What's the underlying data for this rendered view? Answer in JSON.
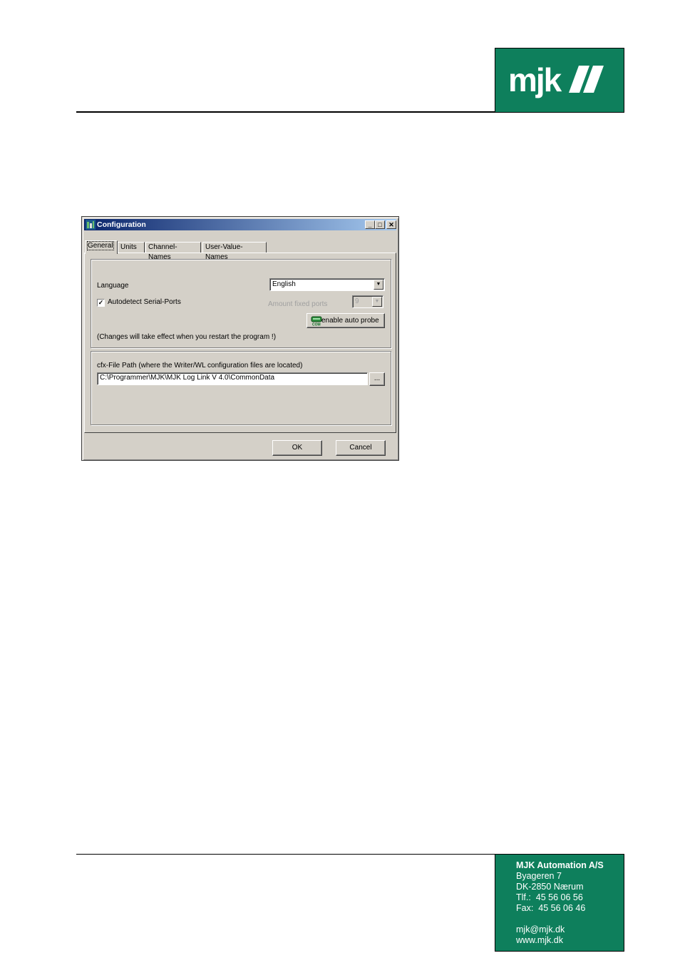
{
  "logo": {
    "text": "mjk//",
    "background": "#0e7f5c"
  },
  "dialog": {
    "title": "Configuration",
    "title_buttons": {
      "minimize": "_",
      "maximize": "□",
      "close": "✕"
    },
    "tabs": [
      "General",
      "Units",
      "Channel-Names",
      "User-Value-Names"
    ],
    "active_tab": "General",
    "language_label": "Language",
    "language_value": "English",
    "autodetect_label": "Autodetect Serial-Ports",
    "autodetect_checked": true,
    "amount_fixed_ports_label": "Amount fixed ports",
    "amount_fixed_ports_value": "9",
    "enable_auto_probe_label": "enable auto probe",
    "changes_note": "(Changes will take effect when you restart the program !)",
    "cfx_path_label": "cfx-File Path (where the Writer/WL configuration files are located)",
    "cfx_path_value": "C:\\Programmer\\MJK\\MJK Log Link V 4.0\\CommonData",
    "browse_label": "...",
    "ok_label": "OK",
    "cancel_label": "Cancel"
  },
  "footer": {
    "company": "MJK Automation A/S",
    "street": "Byageren 7",
    "city": "DK-2850 Nærum",
    "phone": "Tlf.:  45 56 06 56",
    "fax": "Fax:  45 56 06 46",
    "email": "mjk@mjk.dk",
    "web": "www.mjk.dk"
  }
}
